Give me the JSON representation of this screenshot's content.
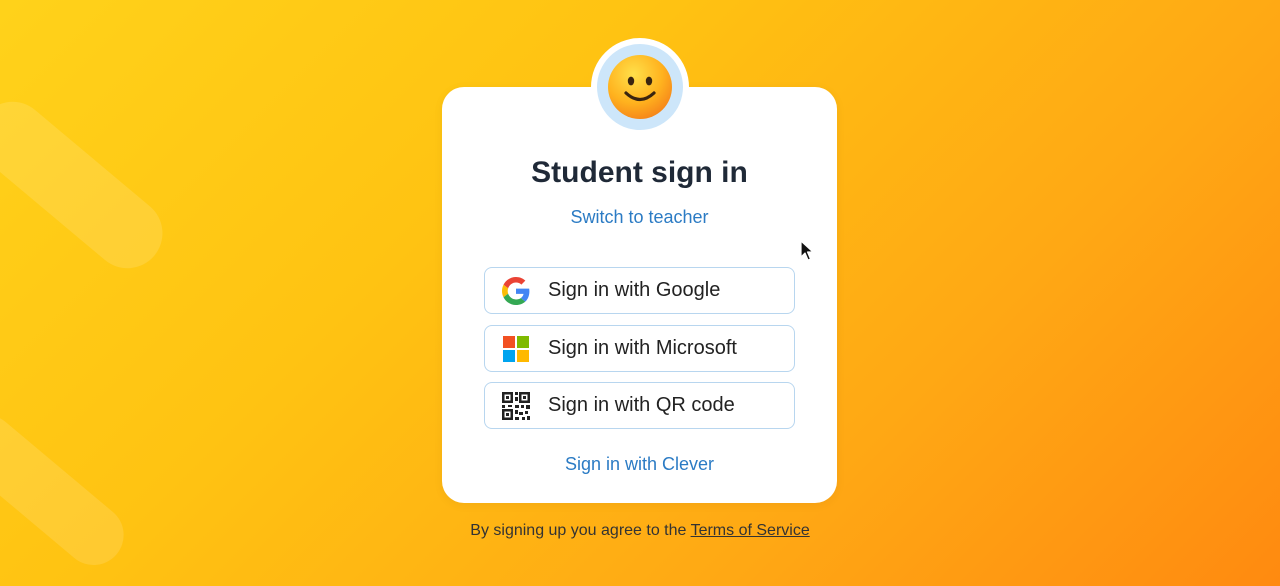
{
  "page": {
    "title": "Student sign in",
    "switch_link": "Switch to teacher",
    "clever_link": "Sign in with Clever"
  },
  "buttons": [
    {
      "label": "Sign in with Google",
      "icon": "google-icon"
    },
    {
      "label": "Sign in with Microsoft",
      "icon": "microsoft-icon"
    },
    {
      "label": "Sign in with QR code",
      "icon": "qr-code-icon"
    }
  ],
  "footer": {
    "prefix": "By signing up you agree to the",
    "terms_link": "Terms of Service"
  },
  "colors": {
    "link": "#2b7bc4",
    "title": "#1f2937",
    "button_border": "#b8d6ef",
    "background_start": "#ffd21a",
    "background_end": "#ff8a10"
  }
}
